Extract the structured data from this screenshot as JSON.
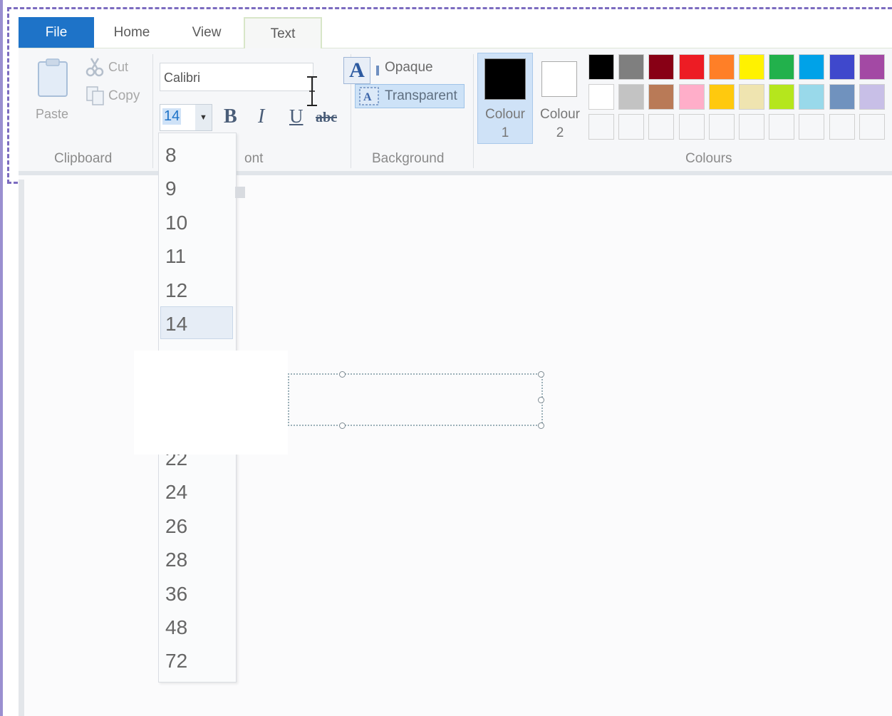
{
  "tabs": [
    {
      "label": "File"
    },
    {
      "label": "Home"
    },
    {
      "label": "View"
    },
    {
      "label": "Text"
    }
  ],
  "clipboard": {
    "group_label": "Clipboard",
    "paste_label": "Paste",
    "cut_label": "Cut",
    "copy_label": "Copy"
  },
  "font": {
    "group_label_partial": "ont",
    "font_name": "Calibri",
    "font_size": "14",
    "bold_label": "B",
    "italic_label": "I",
    "underline_label": "U",
    "strikethrough_label": "abc"
  },
  "background": {
    "group_label": "Background",
    "opaque_label": "Opaque",
    "transparent_label": "Transparent",
    "icon_glyph": "A"
  },
  "colours": {
    "group_label": "Colours",
    "colour1_label": "Colour",
    "colour1_index": "1",
    "colour2_label": "Colour",
    "colour2_index": "2",
    "colour1_value": "#000000",
    "colour2_value": "#ffffff",
    "palette_row1": [
      "#000000",
      "#7f7f7f",
      "#880015",
      "#ed1c24",
      "#ff7f27",
      "#fff200",
      "#22b14c",
      "#00a2e8",
      "#3f48cc",
      "#a349a4"
    ],
    "palette_row2": [
      "#ffffff",
      "#c3c3c3",
      "#b97a57",
      "#ffaec9",
      "#ffc90e",
      "#efe4b0",
      "#b5e61d",
      "#99d9ea",
      "#7092be",
      "#c8bfe7"
    ],
    "palette_row3": [
      "#f6f7f9",
      "#f6f7f9",
      "#f6f7f9",
      "#f6f7f9",
      "#f6f7f9",
      "#f6f7f9",
      "#f6f7f9",
      "#f6f7f9",
      "#f6f7f9",
      "#f6f7f9"
    ]
  },
  "font_size_dropdown": {
    "visible_sizes_top": [
      "8",
      "9",
      "10",
      "11",
      "12",
      "14"
    ],
    "visible_sizes_bottom": [
      "22",
      "24",
      "26",
      "28",
      "36",
      "48",
      "72"
    ],
    "selected": "14"
  },
  "accent_colors": {
    "file_tab": "#1e73c8",
    "selection": "#cde2f7",
    "frame_dash": "#7c6cc0"
  }
}
